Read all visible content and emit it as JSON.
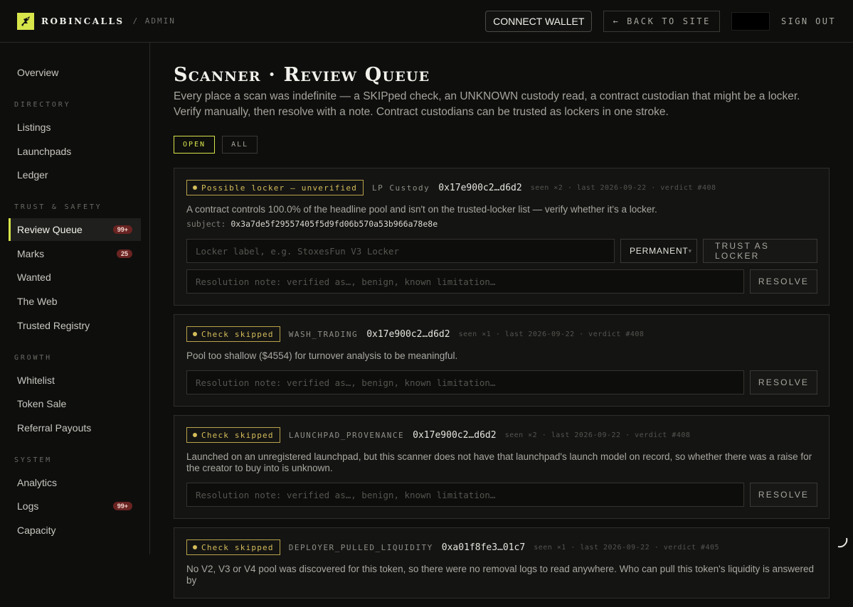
{
  "brand": {
    "name": "ROBINCALLS",
    "section": "/ ADMIN"
  },
  "topbar": {
    "connect_label": "CONNECT WALLET",
    "back_label": "← BACK TO SITE",
    "signout_label": "SIGN OUT"
  },
  "sidebar": {
    "top": [
      {
        "label": "Overview"
      }
    ],
    "sections": [
      {
        "title": "DIRECTORY",
        "items": [
          {
            "label": "Listings"
          },
          {
            "label": "Launchpads"
          },
          {
            "label": "Ledger"
          }
        ]
      },
      {
        "title": "TRUST & SAFETY",
        "items": [
          {
            "label": "Review Queue",
            "badge": "99+",
            "active": true
          },
          {
            "label": "Marks",
            "badge": "25"
          },
          {
            "label": "Wanted"
          },
          {
            "label": "The Web"
          },
          {
            "label": "Trusted Registry"
          }
        ]
      },
      {
        "title": "GROWTH",
        "items": [
          {
            "label": "Whitelist"
          },
          {
            "label": "Token Sale"
          },
          {
            "label": "Referral Payouts"
          }
        ]
      },
      {
        "title": "SYSTEM",
        "items": [
          {
            "label": "Analytics"
          },
          {
            "label": "Logs",
            "badge": "99+"
          },
          {
            "label": "Capacity"
          }
        ]
      }
    ]
  },
  "main": {
    "title": "Scanner · Review Queue",
    "description": "Every place a scan was indefinite — a SKIPped check, an UNKNOWN custody read, a contract custodian that might be a locker. Verify manually, then resolve with a note. Contract custodians can be trusted as lockers in one stroke.",
    "filters": [
      {
        "label": "OPEN",
        "active": true
      },
      {
        "label": "ALL",
        "active": false
      }
    ],
    "cards": [
      {
        "tag": "Possible locker — unverified",
        "check": "LP Custody",
        "address": "0x17e900c2…d6d2",
        "meta": "seen ×2 · last 2026-09-22 · verdict #408",
        "text": "A contract controls 100.0% of the headline pool and isn't on the trusted-locker list — verify whether it's a locker.",
        "subject_label": "subject:",
        "subject": "0x3a7de5f29557405f5d9fd06b570a53b966a78e8e",
        "locker_placeholder": "Locker label, e.g. StoxesFun V3 Locker",
        "select_value": "PERMANENT",
        "trust_label": "TRUST AS LOCKER",
        "note_placeholder": "Resolution note: verified as…, benign, known limitation…",
        "resolve_label": "RESOLVE"
      },
      {
        "tag": "Check skipped",
        "check": "WASH_TRADING",
        "address": "0x17e900c2…d6d2",
        "meta": "seen ×1 · last 2026-09-22 · verdict #408",
        "text": "Pool too shallow ($4554) for turnover analysis to be meaningful.",
        "note_placeholder": "Resolution note: verified as…, benign, known limitation…",
        "resolve_label": "RESOLVE"
      },
      {
        "tag": "Check skipped",
        "check": "LAUNCHPAD_PROVENANCE",
        "address": "0x17e900c2…d6d2",
        "meta": "seen ×2 · last 2026-09-22 · verdict #408",
        "text": "Launched on an unregistered launchpad, but this scanner does not have that launchpad's launch model on record, so whether there was a raise for the creator to buy into is unknown.",
        "note_placeholder": "Resolution note: verified as…, benign, known limitation…",
        "resolve_label": "RESOLVE"
      },
      {
        "tag": "Check skipped",
        "check": "DEPLOYER_PULLED_LIQUIDITY",
        "address": "0xa01f8fe3…01c7",
        "meta": "seen ×1 · last 2026-09-22 · verdict #405",
        "text": "No V2, V3 or V4 pool was discovered for this token, so there were no removal logs to read anywhere. Who can pull this token's liquidity is answered by"
      }
    ]
  }
}
